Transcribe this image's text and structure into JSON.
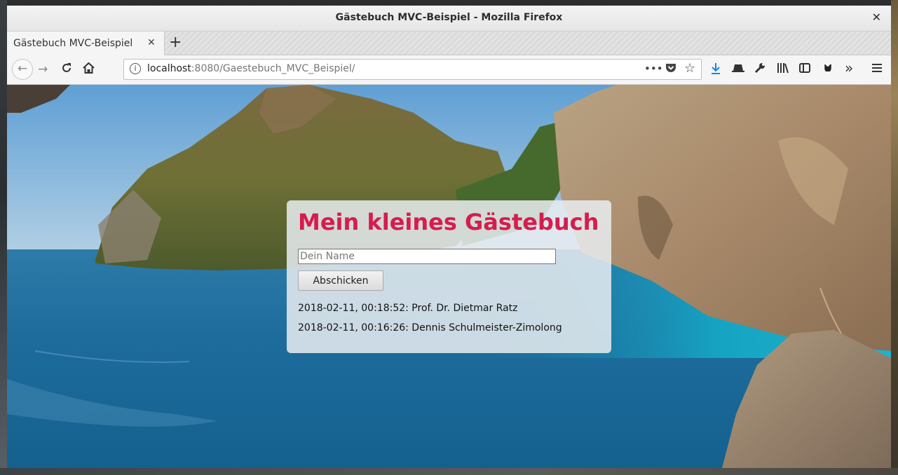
{
  "window": {
    "title": "Gästebuch MVC-Beispiel - Mozilla Firefox",
    "close_glyph": "✕"
  },
  "tabs": [
    {
      "label": "Gästebuch MVC-Beispiel",
      "close_glyph": "✕"
    }
  ],
  "new_tab_glyph": "+",
  "navbar": {
    "url_host": "localhost",
    "url_rest": ":8080/Gaestebuch_MVC_Beispiel/",
    "icons": [
      "back-icon",
      "forward-icon",
      "reload-icon",
      "home-icon",
      "info-icon",
      "more-icon",
      "pocket-icon",
      "bookmark-star-icon",
      "downloads-icon",
      "hat-icon",
      "wrench-icon",
      "library-icon",
      "sidebar-icon",
      "addon-icon",
      "overflow-icon",
      "menu-icon"
    ],
    "accent_color": "#0a84ff"
  },
  "page": {
    "heading": "Mein kleines Gästebuch",
    "heading_color": "#d61c4e",
    "name_placeholder": "Dein Name",
    "name_value": "",
    "submit_label": "Abschicken",
    "entries": [
      {
        "text": "2018-02-11, 00:18:52: Prof. Dr. Dietmar Ratz"
      },
      {
        "text": "2018-02-11, 00:16:26: Dennis Schulmeister-Zimolong"
      }
    ]
  }
}
